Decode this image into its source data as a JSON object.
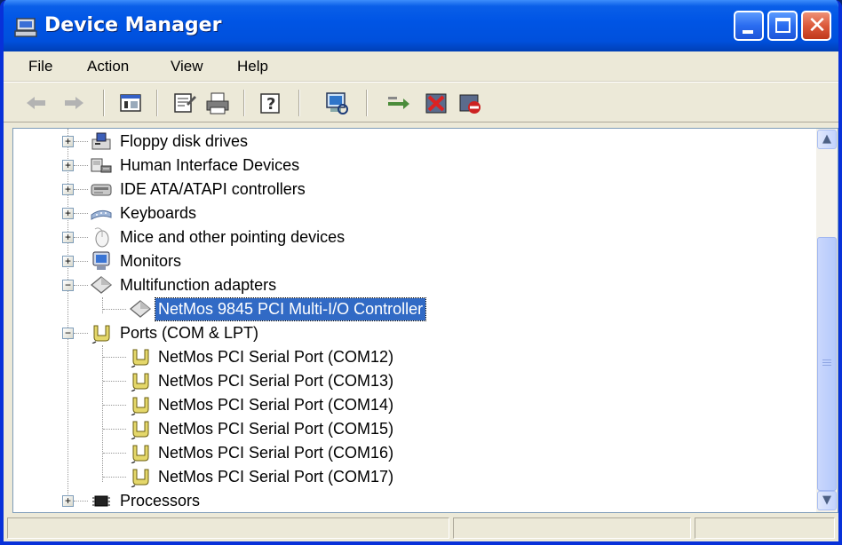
{
  "window": {
    "title": "Device Manager",
    "title_icon": "computer-icon"
  },
  "menu": [
    "File",
    "Action",
    "View",
    "Help"
  ],
  "toolbar": {
    "buttons": [
      "back-icon",
      "forward-icon",
      "show-hide-tree-icon",
      "properties-icon",
      "print-icon",
      "help-icon",
      "scan-hardware-icon",
      "update-driver-icon",
      "uninstall-icon",
      "disable-icon"
    ]
  },
  "tree": {
    "rows": [
      {
        "label": "Floppy disk drives",
        "icon": "floppy-drive-icon",
        "level": 0,
        "expander": "+"
      },
      {
        "label": "Human Interface Devices",
        "icon": "hid-icon",
        "level": 0,
        "expander": "+"
      },
      {
        "label": "IDE ATA/ATAPI controllers",
        "icon": "ide-controller-icon",
        "level": 0,
        "expander": "+"
      },
      {
        "label": "Keyboards",
        "icon": "keyboard-icon",
        "level": 0,
        "expander": "+"
      },
      {
        "label": "Mice and other pointing devices",
        "icon": "mouse-icon",
        "level": 0,
        "expander": "+"
      },
      {
        "label": "Monitors",
        "icon": "monitor-icon",
        "level": 0,
        "expander": "+"
      },
      {
        "label": "Multifunction adapters",
        "icon": "multifunction-adapter-icon",
        "level": 0,
        "expander": "−"
      },
      {
        "label": "NetMos 9845 PCI Multi-I/O Controller",
        "icon": "multifunction-adapter-icon",
        "level": 1,
        "selected": true
      },
      {
        "label": "Ports (COM & LPT)",
        "icon": "port-icon",
        "level": 0,
        "expander": "−"
      },
      {
        "label": "NetMos PCI Serial Port (COM12)",
        "icon": "port-icon",
        "level": 1
      },
      {
        "label": "NetMos PCI Serial Port (COM13)",
        "icon": "port-icon",
        "level": 1
      },
      {
        "label": "NetMos PCI Serial Port (COM14)",
        "icon": "port-icon",
        "level": 1
      },
      {
        "label": "NetMos PCI Serial Port (COM15)",
        "icon": "port-icon",
        "level": 1
      },
      {
        "label": "NetMos PCI Serial Port (COM16)",
        "icon": "port-icon",
        "level": 1
      },
      {
        "label": "NetMos PCI Serial Port (COM17)",
        "icon": "port-icon",
        "level": 1
      },
      {
        "label": "Processors",
        "icon": "processor-icon",
        "level": 0,
        "expander": "+"
      }
    ]
  },
  "colors": {
    "selection": "#316ac5",
    "titlebar": "#0055e5",
    "window_bg": "#ece9d8"
  }
}
